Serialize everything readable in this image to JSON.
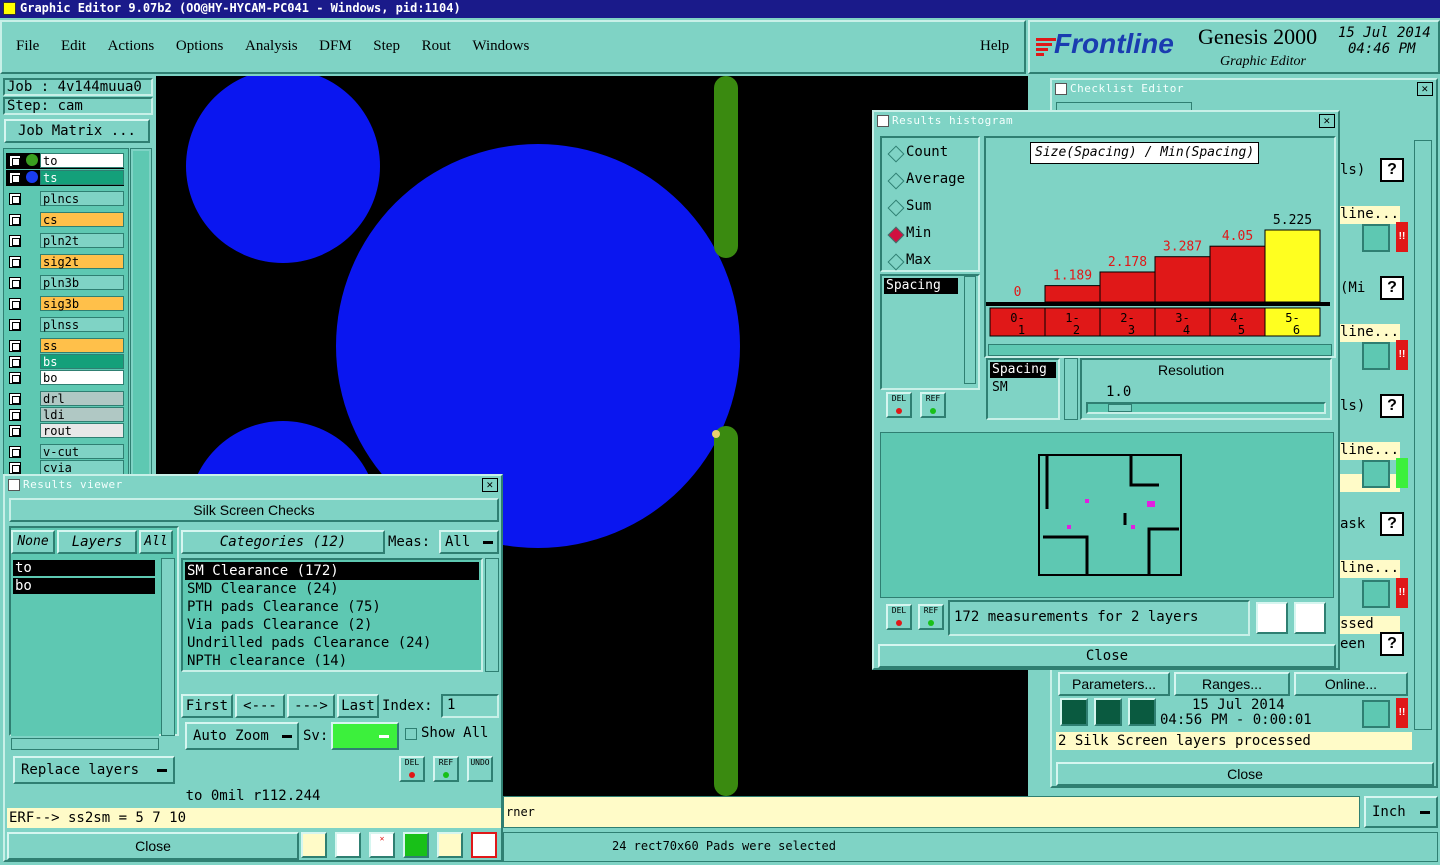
{
  "window": {
    "title": "Graphic Editor 9.07b2 (OO@HY-HYCAM-PC041 - Windows, pid:1104)"
  },
  "menu": {
    "items": [
      "File",
      "Edit",
      "Actions",
      "Options",
      "Analysis",
      "DFM",
      "Step",
      "Rout",
      "Windows"
    ],
    "help": "Help"
  },
  "brand": {
    "logo": "Frontline",
    "product": "Genesis 2000",
    "sub": "Graphic Editor",
    "date": "15 Jul 2014",
    "time": "04:46 PM"
  },
  "job": {
    "job_label": "Job : 4v144muua0",
    "step_label": "Step: cam",
    "matrix_button": "Job Matrix ..."
  },
  "layers": [
    {
      "name": "to",
      "color": "#ffffff"
    },
    {
      "name": "ts",
      "color": "#14a07a"
    },
    {
      "name": "plncs",
      "color": "#7fd3c5"
    },
    {
      "name": "cs",
      "color": "#ffc04a"
    },
    {
      "name": "pln2t",
      "color": "#7fd3c5"
    },
    {
      "name": "sig2t",
      "color": "#ffc04a"
    },
    {
      "name": "pln3b",
      "color": "#7fd3c5"
    },
    {
      "name": "sig3b",
      "color": "#ffc04a"
    },
    {
      "name": "plnss",
      "color": "#7fd3c5"
    },
    {
      "name": "ss",
      "color": "#ffc04a"
    },
    {
      "name": "bs",
      "color": "#14a07a"
    },
    {
      "name": "bo",
      "color": "#ffffff"
    },
    {
      "name": "drl",
      "color": "#b0c8c4"
    },
    {
      "name": "ldi",
      "color": "#b0c8c4"
    },
    {
      "name": "rout",
      "color": "#e8e8e8"
    },
    {
      "name": "v-cut",
      "color": "#7fd3c5"
    },
    {
      "name": "cvia",
      "color": "#7fd3c5"
    }
  ],
  "results_viewer": {
    "title": "Results viewer",
    "header": "Silk Screen Checks",
    "none_btn": "None",
    "layers_btn": "Layers",
    "all_btn": "All",
    "categories_btn": "Categories (12)",
    "meas_label": "Meas:",
    "meas_value": "All",
    "layer_list": [
      "to",
      "bo"
    ],
    "categories": [
      "SM Clearance (172)",
      "SMD Clearance (24)",
      "PTH pads Clearance (75)",
      "Via pads Clearance (2)",
      "Undrilled pads Clearance (24)",
      "NPTH clearance (14)"
    ],
    "first_btn": "First",
    "prev_btn": "<---",
    "next_btn": "--->",
    "last_btn": "Last",
    "index_label": "Index:",
    "index_value": "1",
    "auto_zoom": "Auto Zoom",
    "sv_label": "Sv:",
    "show_all": "Show All",
    "replace_layers": "Replace layers",
    "del": "DEL",
    "ref": "REF",
    "undo": "UNDO",
    "status1": "to 0mil r112.244",
    "status2": "ERF--> ss2sm = 5 7 10",
    "close": "Close"
  },
  "histogram": {
    "title": "Results histogram",
    "options": [
      "Count",
      "Average",
      "Sum",
      "Min",
      "Max"
    ],
    "selected": "Min",
    "label": "Size(Spacing) / Min(Spacing)",
    "list_item": "Spacing",
    "field_header": "Spacing",
    "field_value": "SM",
    "resolution_label": "Resolution",
    "resolution_value": "1.0",
    "measurements": "172 measurements for 2 layers",
    "del": "DEL",
    "ref": "REF",
    "close": "Close"
  },
  "chart_data": {
    "type": "bar",
    "title": "Size(Spacing) / Min(Spacing)",
    "categories": [
      "0-1",
      "1-2",
      "2-3",
      "3-4",
      "4-5",
      "5-6"
    ],
    "values": [
      0,
      1.189,
      2.178,
      3.287,
      4.05,
      5.225
    ],
    "value_labels": [
      "0",
      "1.189",
      "2.178",
      "3.287",
      "4.05",
      "5.225"
    ],
    "highlight_index": 5,
    "colors": {
      "normal": "#e01818",
      "highlight": "#ffff20"
    }
  },
  "checklist": {
    "title": "Checklist Editor",
    "row_labels": [
      "ls)",
      "line...",
      "(Mi",
      "line...",
      "ls)",
      "line...",
      "",
      "ask",
      "line...",
      "ssed",
      "een"
    ],
    "parameters": "Parameters...",
    "ranges": "Ranges...",
    "online": "Online...",
    "run_date": "15 Jul 2014",
    "run_time": "04:56 PM - 0:00:01",
    "processed": "2 Silk Screen layers processed",
    "close": "Close"
  },
  "bottom": {
    "status_text": "rner",
    "units": "Inch",
    "selected_msg": "24 rect70x60 Pads were selected"
  }
}
